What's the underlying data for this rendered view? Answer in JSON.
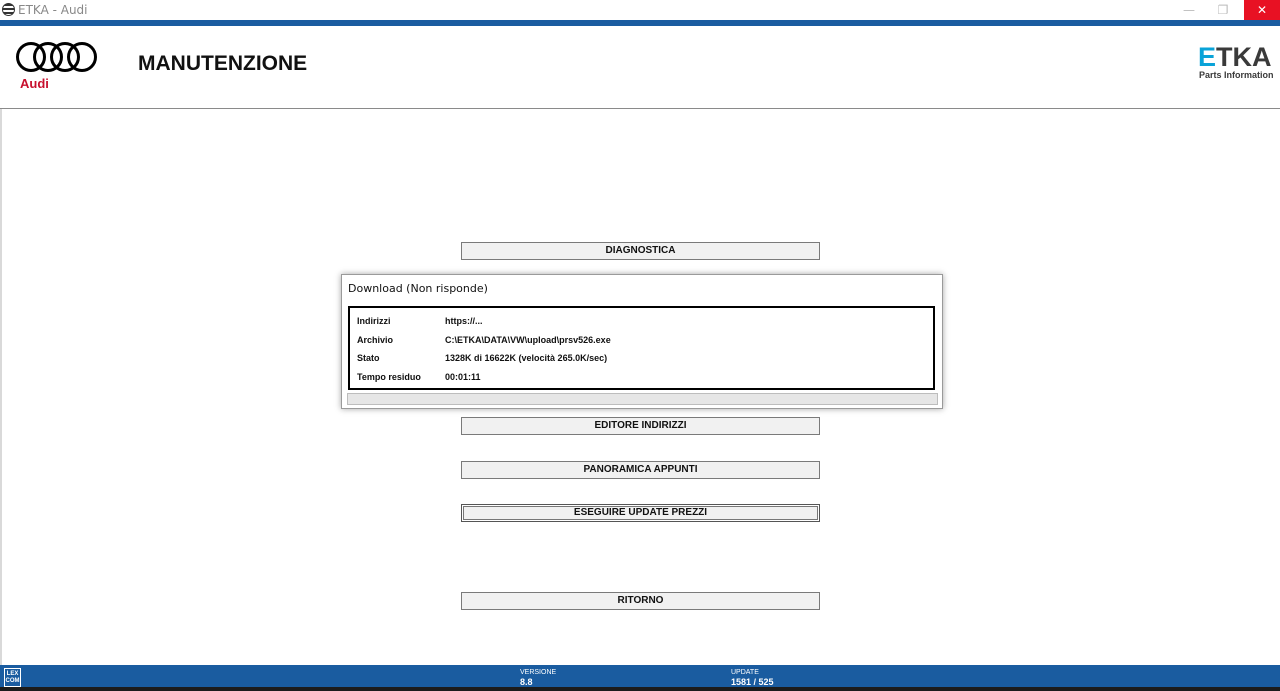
{
  "window": {
    "title": "ETKA - Audi",
    "min_glyph": "—",
    "max_glyph": "❐",
    "close_glyph": "✕"
  },
  "brand": {
    "audi_text": "Audi",
    "etka_e": "E",
    "etka_rest": "TKA",
    "etka_sub": "Parts Information",
    "audi_red": "#c8102e",
    "etka_cyan": "#0aa3d8",
    "header_blue": "#1a5ca0"
  },
  "header": {
    "title": "MANUTENZIONE"
  },
  "menu": {
    "diagnostica": "DIAGNOSTICA",
    "editore": "EDITORE INDIRIZZI",
    "panoramica": "PANORAMICA APPUNTI",
    "eseguire": "ESEGUIRE UPDATE PREZZI",
    "ritorno": "RITORNO"
  },
  "dialog": {
    "title": "Download (Non risponde)",
    "rows": [
      {
        "label": "Indirizzi",
        "value": "https://..."
      },
      {
        "label": "Archivio",
        "value": "C:\\ETKA\\DATA\\VW\\upload\\prsv526.exe"
      },
      {
        "label": "Stato",
        "value": "1328K di 16622K (velocità 265.0K/sec)"
      },
      {
        "label": "Tempo residuo",
        "value": "00:01:11"
      }
    ],
    "progress_fraction": 0
  },
  "footer": {
    "lexcom_line1": "LEX",
    "lexcom_line2": "COM",
    "version_label": "VERSIONE",
    "version_value": "8.8",
    "update_label": "UPDATE",
    "update_value": "1581 / 525"
  }
}
